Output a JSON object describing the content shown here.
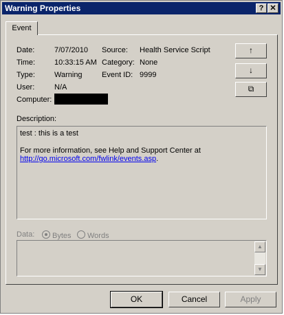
{
  "window": {
    "title": "Warning Properties",
    "help_btn": "?",
    "close_btn": "✕"
  },
  "tab": {
    "label": "Event"
  },
  "fields": {
    "date_label": "Date:",
    "date_value": "7/07/2010",
    "source_label": "Source:",
    "source_value": "Health Service Script",
    "time_label": "Time:",
    "time_value": "10:33:15 AM",
    "category_label": "Category:",
    "category_value": "None",
    "type_label": "Type:",
    "type_value": "Warning",
    "eventid_label": "Event ID:",
    "eventid_value": "9999",
    "user_label": "User:",
    "user_value": "N/A",
    "computer_label": "Computer:"
  },
  "side_buttons": {
    "up": "↑",
    "down": "↓",
    "copy": "⧉"
  },
  "description": {
    "label": "Description:",
    "line1": "test : this is a test",
    "line2": "For more information, see Help and Support Center at",
    "link": "http://go.microsoft.com/fwlink/events.asp",
    "link_suffix": "."
  },
  "data_section": {
    "label": "Data:",
    "bytes": "Bytes",
    "words": "Words",
    "selected": "Bytes"
  },
  "buttons": {
    "ok": "OK",
    "cancel": "Cancel",
    "apply": "Apply"
  }
}
